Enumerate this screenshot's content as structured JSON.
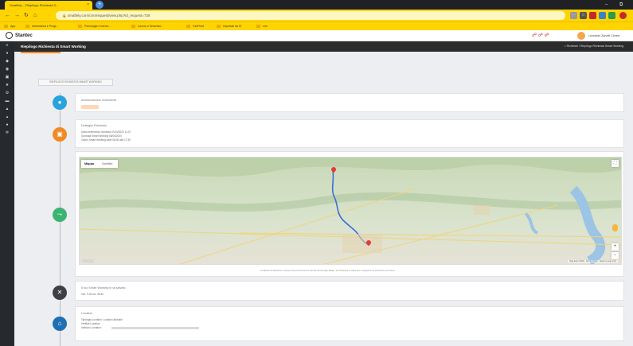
{
  "browser": {
    "tab_title": "Smaftely – Riepilogo Richiesta S...",
    "url": "smaftely.com/crm/request/view.php?id_request=728",
    "bookmarks": [
      "App",
      "Informatica e Progr...",
      "Psicologia e benes...",
      "Lavoro e Smartwo...",
      "FairField",
      "Importati da IE",
      "crm"
    ]
  },
  "app": {
    "brand": "Stantec",
    "user_name": "Leonardo Zanotti Cionne",
    "page_title": "Riepilogo Richiesta di Smart Working",
    "breadcrumb": "Richieste / Riepilogo Richiesta Smart Working",
    "section_tab": "RIEPILOGO RICHIESTA SMART WORKING"
  },
  "timeline": {
    "auth": {
      "title": "Autorizzazione richiedente"
    },
    "details": {
      "title": "Dettaglio Richiesta",
      "line1": "Data inserimento richiesta 07/04/2020 11:37",
      "line2": "Giornata Smart Working 06/04/2020",
      "line3": "Orario Smart Working dalle 08:30 alle 17:30"
    },
    "map": {
      "tab_map": "Mappa",
      "tab_satellite": "Satellite",
      "note": "Il calcolo di distanza e tempo di percorrenza è fornito da Google Maps. La richiesta è stata per il supporto al percorso più breve."
    },
    "saved": {
      "title": "Il tuo Smart Working ti ha salvato",
      "value": "Ore: 9.00 km: 98.40"
    },
    "location": {
      "title": "Location",
      "line1": "Tipologia Location: Location Abituale",
      "line2": "Verifica Location:",
      "line3": "Indirizzo Location:"
    }
  },
  "colors": {
    "accent": "#f08a24",
    "timeline_blue": "#29a3dd",
    "timeline_orange": "#f08a24",
    "timeline_green": "#3cb371",
    "timeline_dark": "#3d3f44",
    "timeline_navy": "#1f6fb5"
  }
}
